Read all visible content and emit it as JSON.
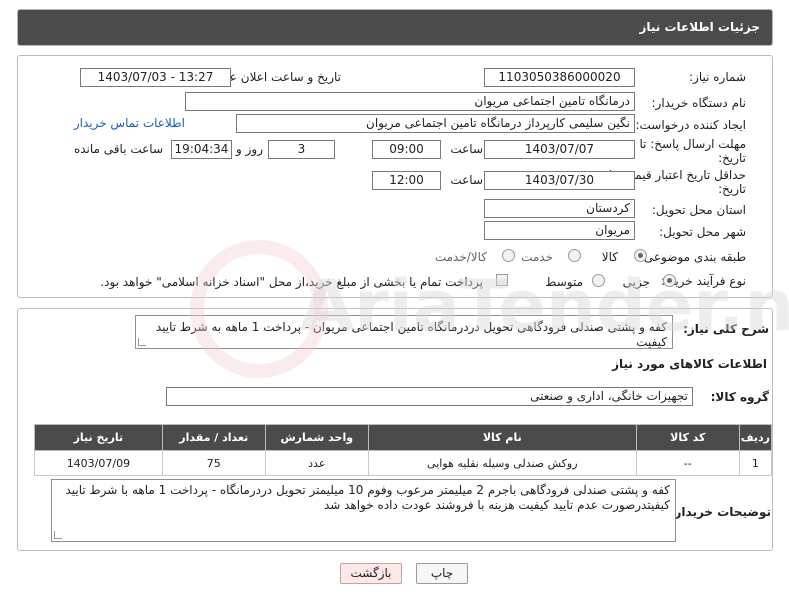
{
  "header": {
    "title": "جزئیات اطلاعات نیاز"
  },
  "form": {
    "need_number_label": "شماره نیاز:",
    "need_number": "1103050386000020",
    "announce_label": "تاریخ و ساعت اعلان عمومی:",
    "announce_value": "1403/07/03 - 13:27",
    "buyer_org_label": "نام دستگاه خریدار:",
    "buyer_org": "درمانگاه تامین اجتماعی مریوان",
    "requester_label": "ایجاد کننده درخواست:",
    "requester": "نگین سلیمی کارپرداز درمانگاه تامین اجتماعی مریوان",
    "contact_link": "اطلاعات تماس خریدار",
    "reply_deadline_label_1": "مهلت ارسال پاسخ: تا",
    "reply_deadline_label_2": "تاریخ:",
    "reply_date": "1403/07/07",
    "time_label": "ساعت",
    "reply_time": "09:00",
    "days_value": "3",
    "days_label": "روز و",
    "remaining_time": "19:04:34",
    "remaining_label": "ساعت باقی مانده",
    "price_validity_label_1": "حداقل تاریخ اعتبار قیمت: تا",
    "price_validity_label_2": "تاریخ:",
    "price_date": "1403/07/30",
    "price_time": "12:00",
    "province_label": "استان محل تحویل:",
    "province": "کردستان",
    "city_label": "شهر محل تحویل:",
    "city": "مریوان",
    "category_label": "طبقه بندی موضوعی:",
    "category_options": [
      "کالا",
      "خدمت",
      "کالا/خدمت"
    ],
    "category_selected": "کالا",
    "process_label": "نوع فرآیند خرید :",
    "process_options": [
      "جزیی",
      "متوسط"
    ],
    "process_selected": "جزیی",
    "payment_note": "پرداخت تمام یا بخشی از مبلغ خرید،از محل \"اسناد خزانه اسلامی\" خواهد بود."
  },
  "description": {
    "label": "شرح کلی نیاز:",
    "text": "کفه و پشتی صندلی فرودگاهی تحویل دردرمانگاه تامین اجتماعی مریوان - پرداخت 1 ماهه به شرط تایید کیفیت"
  },
  "goods": {
    "section_title": "اطلاعات کالاهای مورد نیاز",
    "group_label": "گروه کالا:",
    "group_value": "تجهیزات خانگی، اداری و صنعتی",
    "columns": [
      "ردیف",
      "کد کالا",
      "نام کالا",
      "واحد شمارش",
      "تعداد / مقدار",
      "تاریخ نیاز"
    ],
    "rows": [
      {
        "row": "1",
        "code": "--",
        "name": "روکش صندلی وسیله نقلیه هوایی",
        "unit": "عدد",
        "qty": "75",
        "date": "1403/07/09"
      }
    ]
  },
  "buyer_notes": {
    "label": "توضیحات خریدار:",
    "text": "کفه و پشتی صندلی فرودگاهی باجرم 2 میلیمتر مرعوب وفوم 10 میلیمتر تحویل دردرمانگاه - پرداخت 1 ماهه با شرط تایید کیفیتدرصورت عدم تایید کیفیت هزینه با فروشند عودت داده خواهد شد"
  },
  "buttons": {
    "print": "چاپ",
    "back": "بازگشت"
  },
  "watermark": "AriaTender.neT",
  "colors": {
    "header_bg": "#4b4b4b",
    "link": "#1a5fb4",
    "back_button_bg": "#fde8e8"
  }
}
